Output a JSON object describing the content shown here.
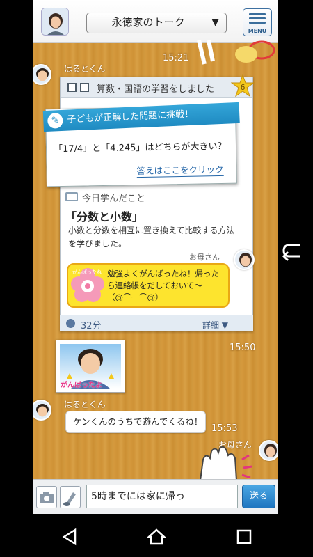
{
  "header": {
    "title": "永徳家のトーク",
    "caret": "▼",
    "menu_label": "MENU"
  },
  "timeline": {
    "time1": "15:21",
    "sender1": "はるとくん",
    "time2": "15:50",
    "sender2": "はるとくん",
    "time3": "15:53",
    "mother_label_bottom": "お母さん"
  },
  "study_card": {
    "title": "算数・国語の学習をしました",
    "level": "6",
    "challenge_header": "子どもが正解した問題に挑戦！",
    "question": "「17/4」と「4.245」はどちらが大きい？",
    "answer_link": "答えはここをクリック",
    "learned_heading": "今日学んだこと",
    "learned_title": "「分数と小数」",
    "learned_desc": "小数と分数を相互に置き換えて比較する方法を学びました。",
    "mother_label": "お母さん",
    "mother_comment": "勉強よくがんばったね！帰ったら連絡帳をだしておいて～（@⌒ー⌒@）",
    "stamp_text": "がんばったね",
    "duration": "32分",
    "more_label": "詳細 ▼"
  },
  "photo": {
    "caption": "がんばったよ"
  },
  "message": {
    "text": "ケンくんのうちで遊んでくるね！"
  },
  "input": {
    "value": "5時までには家に帰っ",
    "send_label": "送る"
  },
  "colors": {
    "accent": "#1f8bc2",
    "wood": "#d39b40",
    "bubble_yellow": "#fde42e",
    "send_blue": "#1f76c0"
  }
}
